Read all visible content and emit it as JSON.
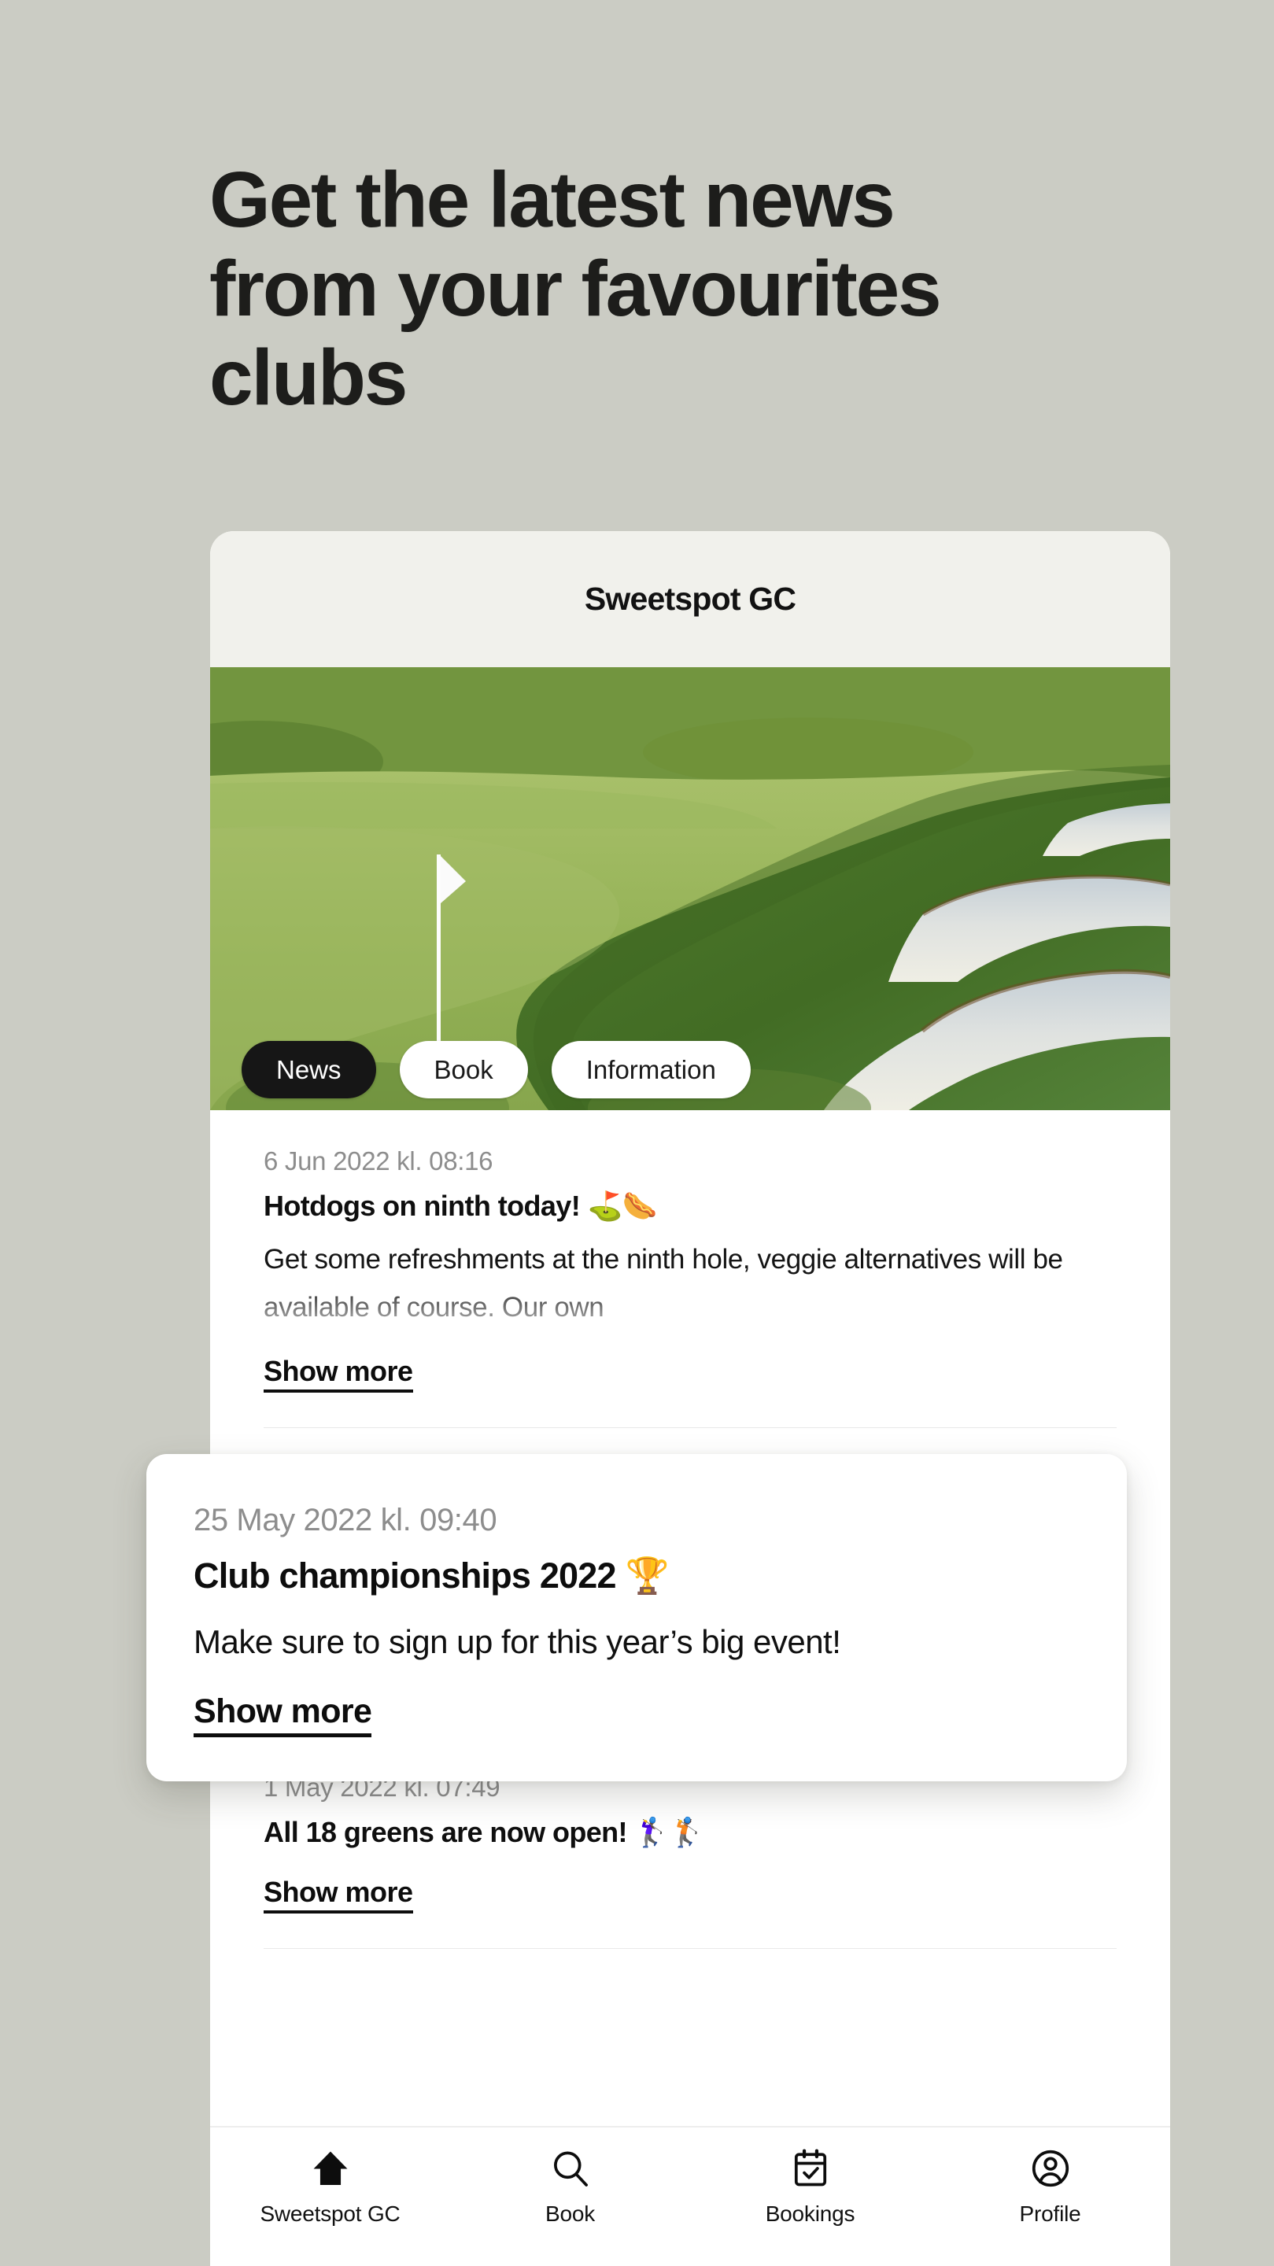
{
  "page": {
    "background_color": "#cbccc4",
    "headline_lines": [
      "Get the latest news",
      "from your favourites",
      "clubs"
    ]
  },
  "phone": {
    "header": {
      "title": "Sweetspot GC"
    },
    "hero": {
      "image_description": "aerial photo of a golf green with white flagstick and sand bunkers",
      "tabs": [
        {
          "label": "News",
          "active": true
        },
        {
          "label": "Book",
          "active": false
        },
        {
          "label": "Information",
          "active": false
        }
      ]
    },
    "news": {
      "items": [
        {
          "date": "6 Jun 2022 kl. 08:16",
          "title": "Hotdogs on ninth today!",
          "title_emoji": "⛳🌭",
          "body": "Get some refreshments at the ninth hole, veggie alternatives will be available of course. Our own",
          "show_more": "Show more"
        },
        {
          "date": "1 May 2022 kl. 07:49",
          "title": "All 18 greens are now open!",
          "title_emoji": "🏌️‍♀️🏌️",
          "body": "",
          "show_more": "Show more"
        }
      ]
    },
    "bottom_nav": [
      {
        "icon": "home-icon",
        "label": "Sweetspot GC",
        "active": true
      },
      {
        "icon": "search-icon",
        "label": "Book",
        "active": false
      },
      {
        "icon": "calendar-check-icon",
        "label": "Bookings",
        "active": false
      },
      {
        "icon": "person-circle-icon",
        "label": "Profile",
        "active": false
      }
    ]
  },
  "overlay_card": {
    "date": "25 May 2022 kl. 09:40",
    "title": "Club championships 2022",
    "title_emoji": "🏆",
    "body": "Make sure to sign up for this year’s big event!",
    "show_more": "Show more"
  }
}
